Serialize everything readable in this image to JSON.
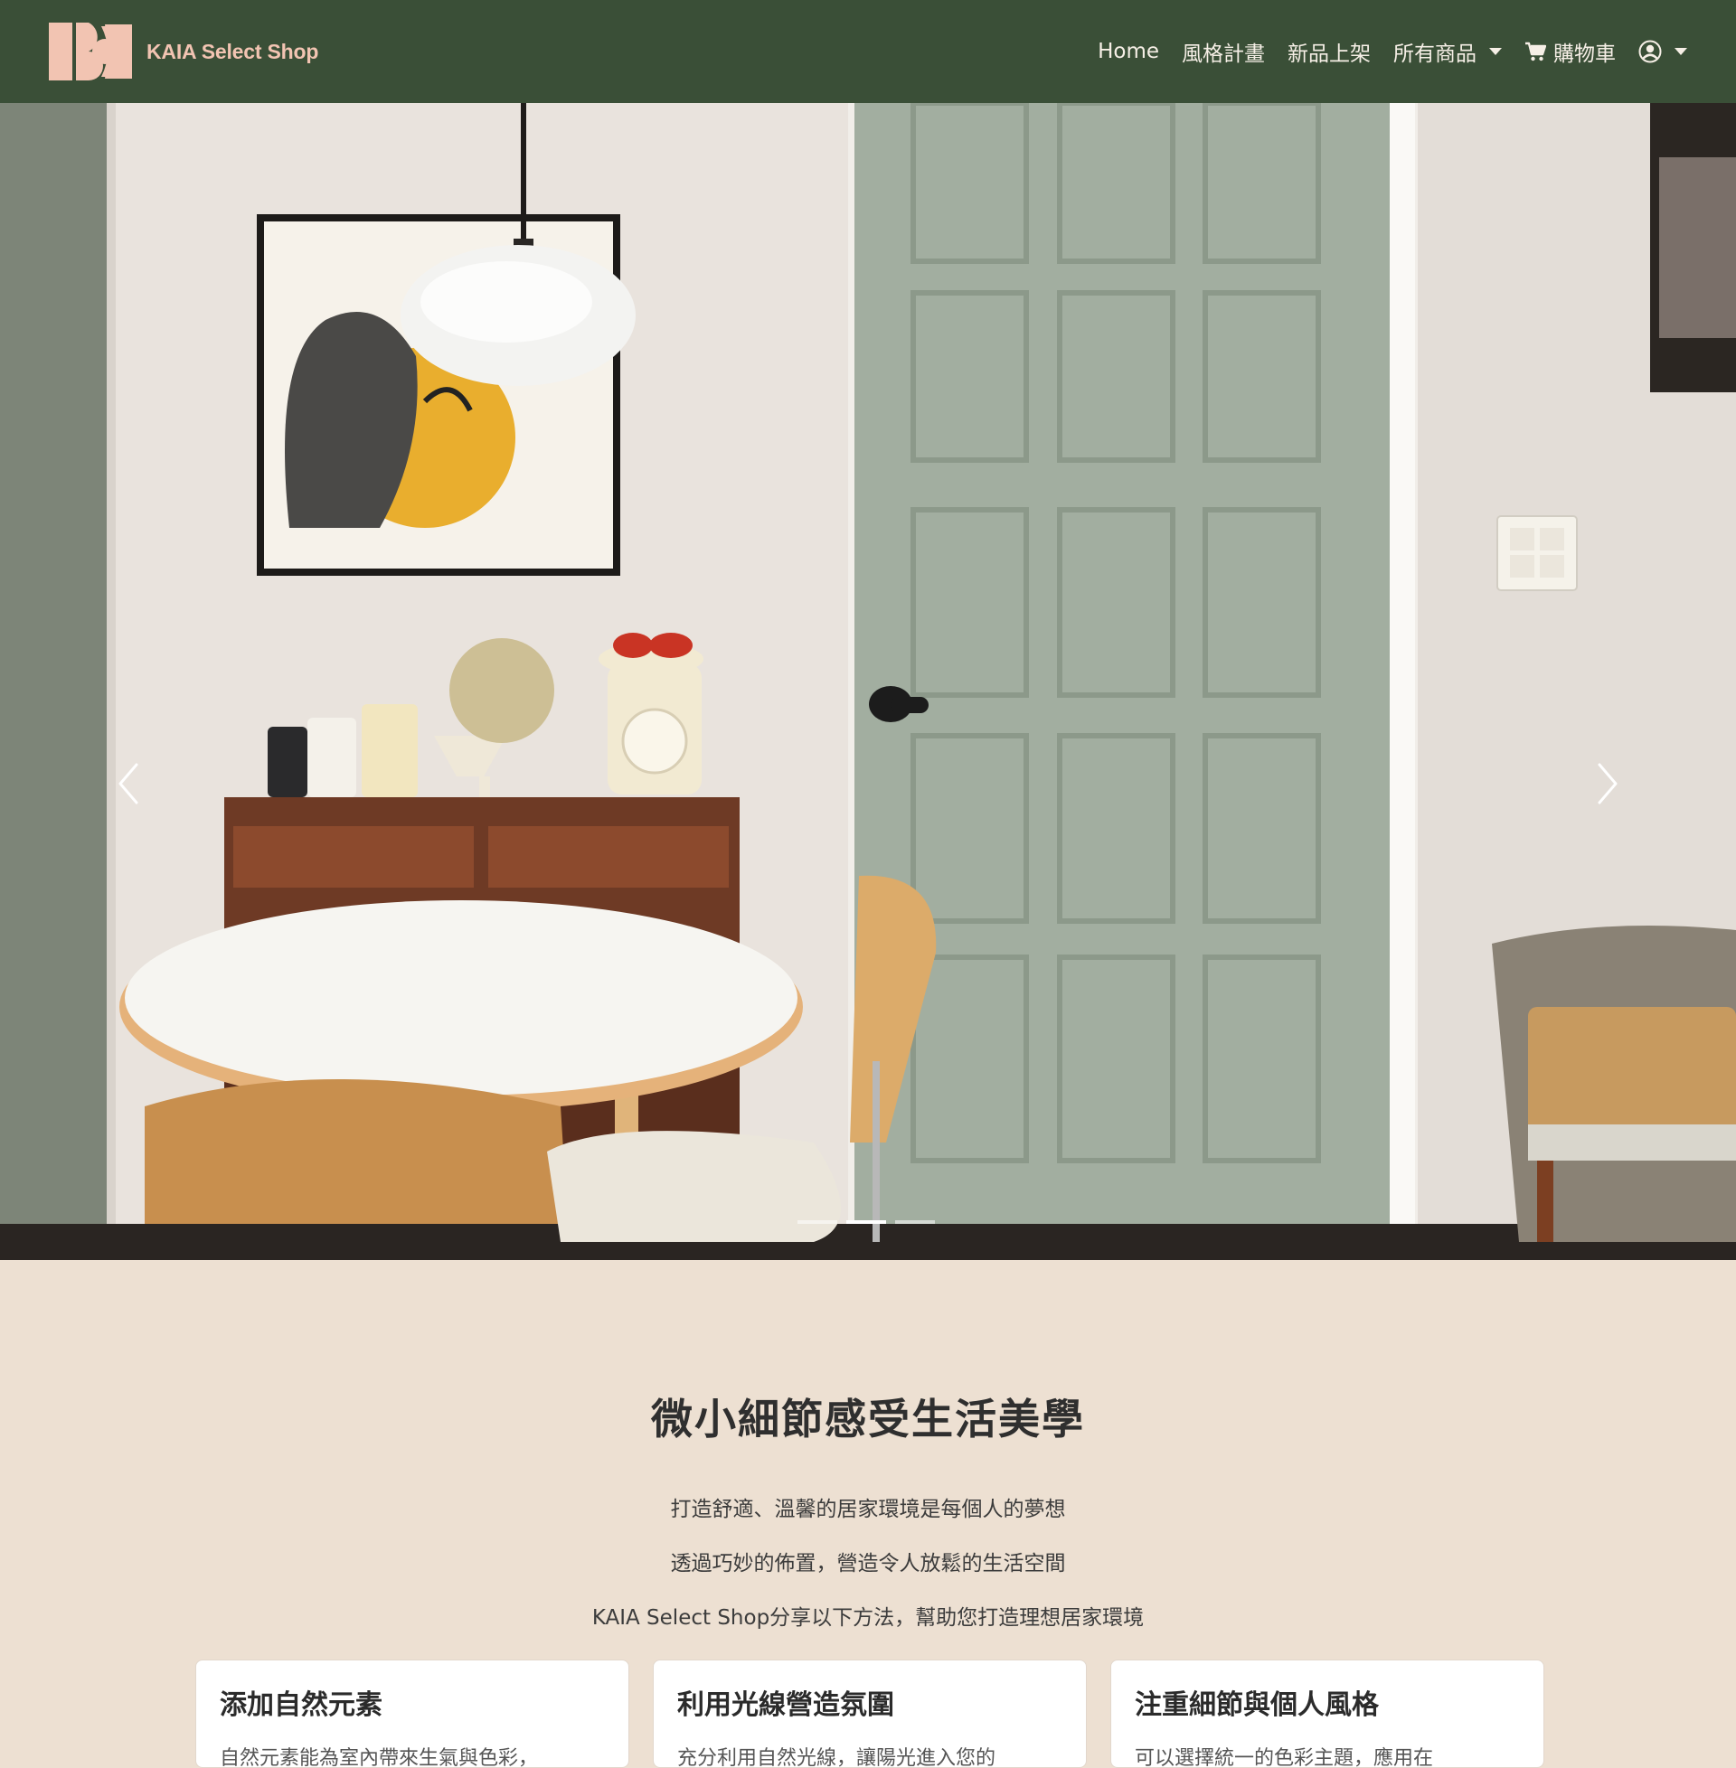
{
  "brand": {
    "name": "KAIA Select Shop",
    "logo_color": "#f2c4b2"
  },
  "navbar": {
    "background": "#3a4f37",
    "items": [
      {
        "label": "Home"
      },
      {
        "label": "風格計畫"
      },
      {
        "label": "新品上架"
      },
      {
        "label": "所有商品",
        "dropdown": true
      },
      {
        "label": "購物車",
        "icon": "cart-icon"
      },
      {
        "label": "",
        "icon": "user-circle-icon",
        "dropdown": true
      }
    ]
  },
  "hero": {
    "slide_count": 3,
    "active_slide": 2,
    "prev_icon": "chevron-left-icon",
    "next_icon": "chevron-right-icon"
  },
  "intro": {
    "title": "微小細節感受生活美學",
    "lines": [
      "打造舒適、溫馨的居家環境是每個人的夢想",
      "透過巧妙的佈置，營造令人放鬆的生活空間",
      "KAIA Select Shop分享以下方法，幫助您打造理想居家環境"
    ],
    "background": "#ede0d2"
  },
  "cards": [
    {
      "title": "添加自然元素",
      "text": "自然元素能為室內帶來生氣與色彩，"
    },
    {
      "title": "利用光線營造氛圍",
      "text": "充分利用自然光線，讓陽光進入您的"
    },
    {
      "title": "注重細節與個人風格",
      "text": "可以選擇統一的色彩主題，應用在"
    }
  ]
}
